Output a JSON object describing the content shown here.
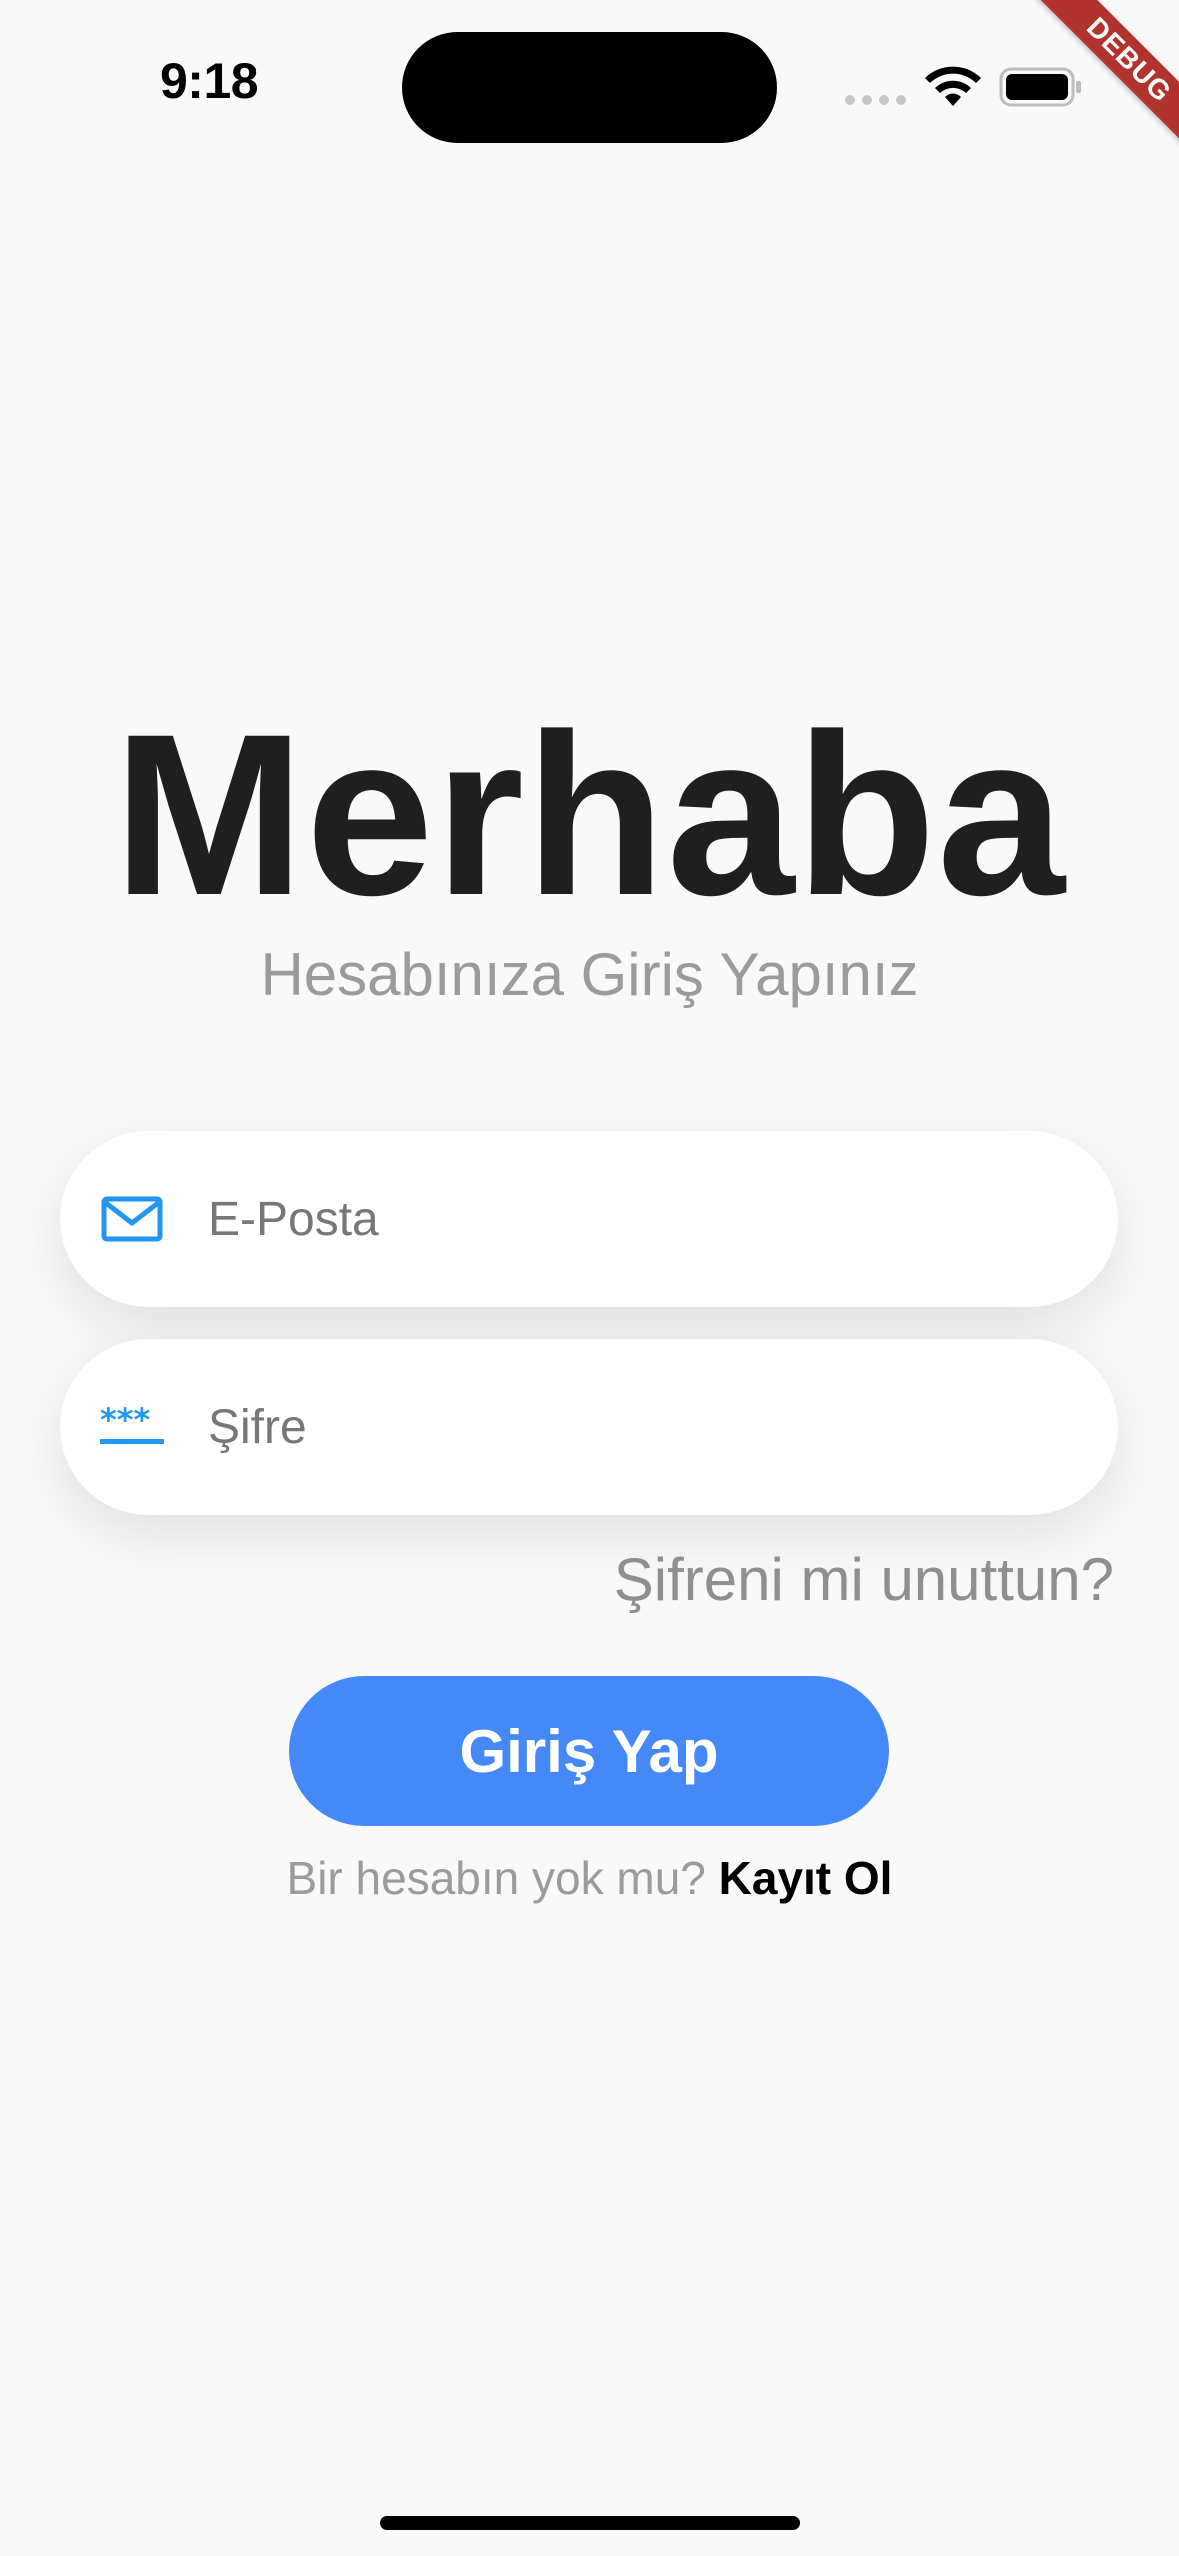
{
  "status_bar": {
    "time": "9:18"
  },
  "debug_banner": {
    "label": "DEBUG"
  },
  "header": {
    "title": "Merhaba",
    "subtitle": "Hesabınıza Giriş Yapınız"
  },
  "form": {
    "email": {
      "placeholder": "E-Posta",
      "value": "",
      "icon": "mail-icon"
    },
    "password": {
      "placeholder": "Şifre",
      "value": "",
      "icon": "password-icon"
    },
    "forgot_password_label": "Şifreni mi unuttun?",
    "login_button_label": "Giriş Yap"
  },
  "signup": {
    "prompt": "Bir hesabın yok mu?",
    "link_label": "Kayıt Ol"
  },
  "colors": {
    "accent": "#4489f7",
    "icon_blue": "#2196f3",
    "background": "#f9f9f9",
    "debug_banner": "#b0332d"
  }
}
